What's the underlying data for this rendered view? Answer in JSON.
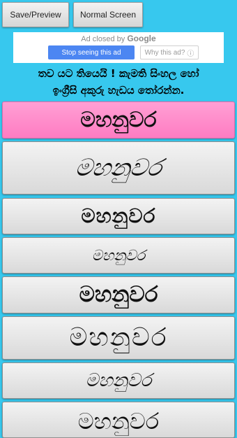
{
  "toolbar": {
    "save_preview_label": "Save/Preview",
    "normal_screen_label": "Normal Screen"
  },
  "ad": {
    "closed_text": "Ad closed by",
    "brand": "Google",
    "stop_label": "Stop seeing this ad",
    "why_label": "Why this ad?",
    "why_icon": "ⓘ"
  },
  "instructions": "තව යට තියෙයි ! කැමති සිංහල හෝ\nඉංග්‍රීසි අකුරු හැඩය තෝරන්න.",
  "font_list": {
    "selected_index": 0,
    "colors": {
      "selected": "#ff8fcb",
      "background": "#37c8ee"
    },
    "items": [
      {
        "label": "මහනුවර",
        "font_style": "bold-sans"
      },
      {
        "label": "මහනුවර",
        "font_style": "italic-script"
      },
      {
        "label": "මහනුවර",
        "font_style": "heavy-bold"
      },
      {
        "label": "මහනුවර",
        "font_style": "small-script"
      },
      {
        "label": "මහනුවර",
        "font_style": "extra-bold"
      },
      {
        "label": "මහනුවර",
        "font_style": "light-rounded"
      },
      {
        "label": "මහනුවර",
        "font_style": "handwritten"
      },
      {
        "label": "මහනුවර",
        "font_style": "outline"
      }
    ]
  }
}
